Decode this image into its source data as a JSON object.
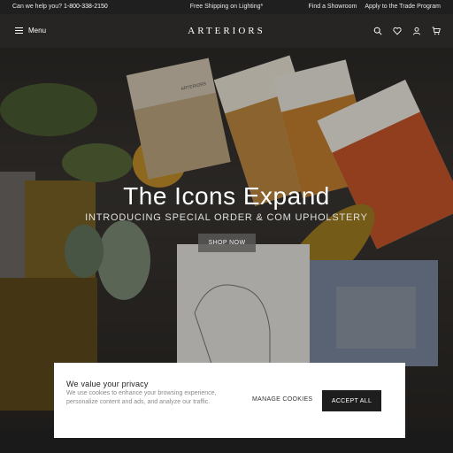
{
  "topbar": {
    "help_prefix": "Can we help you? ",
    "phone": "1-800-338-2150",
    "shipping": "Free Shipping on Lighting*",
    "showroom_link": "Find a Showroom",
    "trade_link": "Apply to the Trade Program"
  },
  "nav": {
    "menu_label": "Menu",
    "logo": "ARTERIORS",
    "icons": [
      "search-icon",
      "heart-icon",
      "user-icon",
      "cart-icon"
    ]
  },
  "hero": {
    "title": "The Icons Expand",
    "subtitle": "INTRODUCING SPECIAL ORDER & COM UPHOLSTERY",
    "cta": "SHOP NOW",
    "swatch_brand": "ARTERIORS"
  },
  "cookie": {
    "title": "We value your privacy",
    "description": "We use cookies to enhance your browsing experience, personalize content and ads, and analyze our traffic.",
    "manage_label": "MANAGE COOKIES",
    "accept_label": "ACCEPT ALL"
  },
  "colors": {
    "topbar_bg": "#1f1f1f",
    "accept_bg": "#1e1e1e",
    "swatch_orange": "#c8572a",
    "swatch_ochre": "#c48a3c"
  }
}
